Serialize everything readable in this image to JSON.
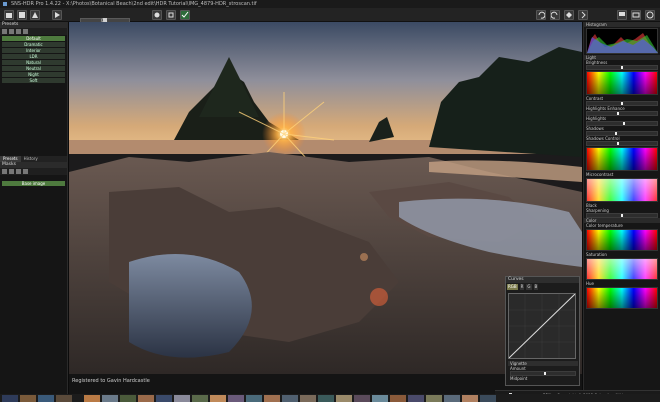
{
  "app": {
    "title": "SNS-HDR Pro 1.4.22 - X:\\Photos\\Botanical Beach\\2nd edit\\HDR Tutorial\\IMG_4879-HDR_stroscan.tif"
  },
  "toolbar": {
    "zoom_value": "0%"
  },
  "left_panel": {
    "presets_header": "Presets",
    "presets": [
      "Default",
      "Dramatic",
      "Interior",
      "LDR",
      "Natural",
      "Neutral",
      "Night",
      "Soft"
    ],
    "selected_preset": "Default",
    "tabs": [
      "Presets",
      "History"
    ],
    "masks_header": "Masks",
    "base_image_label": "Base image"
  },
  "status": {
    "registered": "Registered to Gavin Hardcastle"
  },
  "right_panel": {
    "histogram_label": "Histogram",
    "light_label": "Light",
    "brightness_label": "Brightness",
    "contrast_label": "Contrast",
    "highlight_label": "Highlights Enhance",
    "highlights_label": "Highlights",
    "shadows_label": "Shadows",
    "shadow_control_label": "Shadows Control",
    "microcontrast_label": "Microcontrast",
    "black_label": "Black",
    "sharpening_label": "Sharpening",
    "color_label": "Color",
    "saturation_label": "Saturation",
    "hue_label": "Hue",
    "vibrance_label": "Vibrance",
    "color_temp_label": "Color temperature"
  },
  "curves": {
    "title": "Curves",
    "channels": [
      "RGB",
      "R",
      "G",
      "B"
    ],
    "vignette_label": "Vignette",
    "amount_label": "Amount",
    "midpoint_label": "Midpoint"
  },
  "footer": {
    "zoom_percent": "25%",
    "copyright": "Copyright © 2012 Sebastian Nibisz"
  }
}
